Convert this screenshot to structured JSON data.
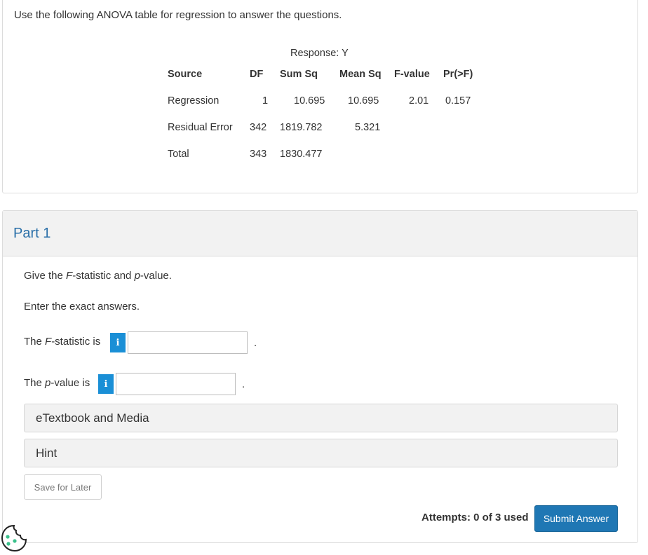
{
  "question": {
    "intro": "Use the following ANOVA table for regression to answer the questions.",
    "anova": {
      "response_label": "Response: Y",
      "headers": [
        "Source",
        "DF",
        "Sum Sq",
        "Mean Sq",
        "F-value",
        "Pr(>F)"
      ],
      "rows": [
        {
          "source": "Regression",
          "df": "1",
          "sum_sq": "10.695",
          "mean_sq": "10.695",
          "f_value": "2.01",
          "p_value": "0.157"
        },
        {
          "source": "Residual Error",
          "df": "342",
          "sum_sq": "1819.782",
          "mean_sq": "5.321",
          "f_value": "",
          "p_value": ""
        },
        {
          "source": "Total",
          "df": "343",
          "sum_sq": "1830.477",
          "mean_sq": "",
          "f_value": "",
          "p_value": ""
        }
      ]
    }
  },
  "part": {
    "title": "Part 1",
    "prompt_prefix": "Give the ",
    "prompt_f": "F",
    "prompt_mid": "-statistic and ",
    "prompt_p": "p",
    "prompt_suffix": "-value.",
    "instruction": "Enter the exact answers.",
    "f_label_prefix": "The ",
    "f_label_italic": "F",
    "f_label_suffix": "-statistic is",
    "f_value": "",
    "p_label_prefix": "The ",
    "p_label_italic": "p",
    "p_label_suffix": "-value is",
    "p_value": "",
    "info_glyph": "i",
    "period": ".",
    "etextbook_label": "eTextbook and Media",
    "hint_label": "Hint",
    "save_label": "Save for Later",
    "attempts_text": "Attempts: 0 of 3 used",
    "submit_label": "Submit Answer"
  },
  "colors": {
    "accent": "#1f77b4",
    "info": "#1a8fd6",
    "part_title": "#2a6fa8"
  },
  "icons": {
    "info": "info-icon",
    "cookie": "cookie-icon"
  }
}
